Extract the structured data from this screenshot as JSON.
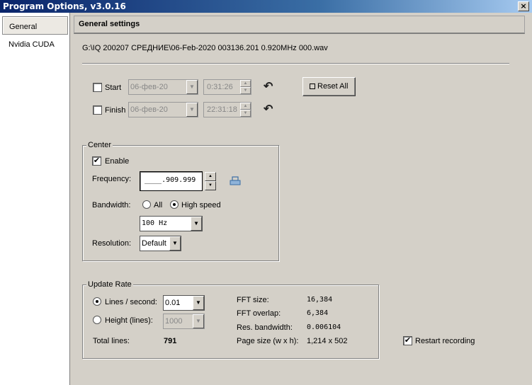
{
  "window": {
    "title": "Program Options, v3.0.16",
    "close": "×"
  },
  "sidebar": {
    "items": [
      {
        "label": "General"
      },
      {
        "label": "Nvidia CUDA"
      }
    ]
  },
  "header": {
    "title": "General settings"
  },
  "file": {
    "path": "G:\\IQ 200207 СРЕДНИЕ\\06-Feb-2020 003136.201 0.920MHz 000.wav"
  },
  "time_range": {
    "start": {
      "label": "Start",
      "date": "06-фев-20",
      "time": "0:31:26"
    },
    "finish": {
      "label": "Finish",
      "date": "06-фев-20",
      "time": "22:31:18"
    },
    "undo_icon": "↶",
    "reset_label": "Reset All"
  },
  "center": {
    "legend": "Center",
    "enable_label": "Enable",
    "enable_checked": "✔",
    "frequency_label": "Frequency:",
    "frequency_value": "____.909.999",
    "bandwidth_label": "Bandwidth:",
    "bw_all": "All",
    "bw_high": "High speed",
    "bw_value": "100 Hz",
    "resolution_label": "Resolution:",
    "resolution_value": "Default"
  },
  "update_rate": {
    "legend": "Update Rate",
    "lines_label": "Lines / second:",
    "lines_value": "0.01",
    "height_label": "Height (lines):",
    "height_value": "1000",
    "total_label": "Total lines:",
    "total_value": "791",
    "fft_size_label": "FFT size:",
    "fft_size_value": "16,384",
    "fft_overlap_label": "FFT overlap:",
    "fft_overlap_value": "6,384",
    "res_bw_label": "Res. bandwidth:",
    "res_bw_value": "0.006104",
    "page_size_label": "Page size (w x h):",
    "page_size_value": "1,214 x 502"
  },
  "restart": {
    "label": "Restart recording",
    "checked": "✔"
  },
  "icons": {
    "dropdown": "▼",
    "spin_up": "▲",
    "spin_down": "▼"
  }
}
